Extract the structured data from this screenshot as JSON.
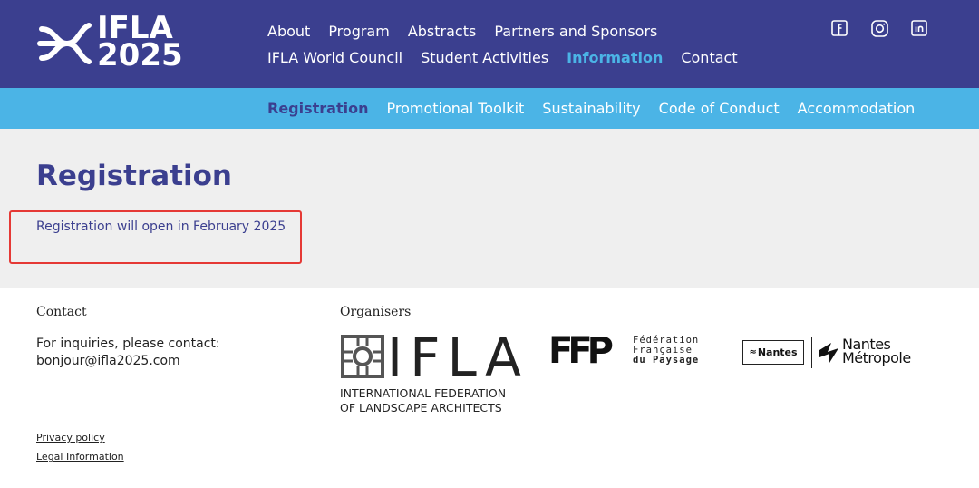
{
  "brand": {
    "logo_line1": "IFLA",
    "logo_line2": "2025"
  },
  "main_nav": {
    "row1": [
      "About",
      "Program",
      "Abstracts",
      "Partners and Sponsors"
    ],
    "row2": [
      "IFLA World Council",
      "Student Activities",
      "Information",
      "Contact"
    ],
    "active": "Information"
  },
  "social": [
    "facebook-icon",
    "instagram-icon",
    "linkedin-icon"
  ],
  "sub_nav": {
    "items": [
      "Registration",
      "Promotional Toolkit",
      "Sustainability",
      "Code of Conduct",
      "Accommodation"
    ],
    "active": "Registration"
  },
  "main": {
    "title": "Registration",
    "notice": "Registration will open in February 2025",
    "notice_border_color": "#e53935"
  },
  "footer": {
    "contact_heading": "Contact",
    "contact_text": "For inquiries, please contact:",
    "contact_email": "bonjour@ifla2025.com",
    "organisers_heading": "Organisers",
    "ifla_word": "IFLA",
    "ifla_sub1": "INTERNATIONAL FEDERATION",
    "ifla_sub2": "OF LANDSCAPE ARCHITECTS",
    "ffp_mark": "FFP",
    "ffp_line1": "Fédération",
    "ffp_line2": "Française",
    "ffp_line3": "du Paysage",
    "nantes_box": "Nantes",
    "nantes_metro1": "Nantes",
    "nantes_metro2": "Métropole",
    "privacy": "Privacy policy",
    "legal": "Legal Information"
  },
  "colors": {
    "primary": "#3b3f8f",
    "accent": "#4bb4e6",
    "background": "#efefef"
  }
}
